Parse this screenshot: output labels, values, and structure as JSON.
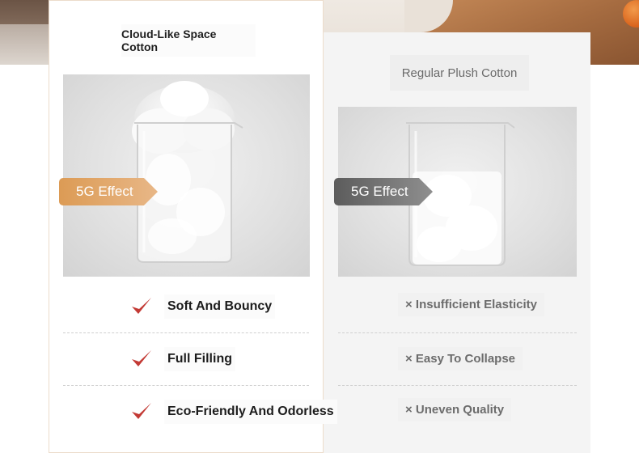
{
  "comparison": {
    "left": {
      "title": "Cloud-Like Space Cotton",
      "badge": "5G Effect",
      "features": [
        {
          "text": "Soft And Bouncy",
          "icon": "check-icon"
        },
        {
          "text": "Full Filling",
          "icon": "check-icon"
        },
        {
          "text": "Eco-Friendly And Odorless",
          "icon": "check-icon"
        }
      ]
    },
    "right": {
      "title": "Regular Plush Cotton",
      "badge": "5G Effect",
      "features": [
        {
          "text": "× Insufficient Elasticity"
        },
        {
          "text": "× Easy To Collapse"
        },
        {
          "text": "× Uneven Quality"
        }
      ]
    }
  },
  "colors": {
    "check_red": "#c33a35",
    "badge_left": "#dc9b55",
    "badge_right": "#6a6a6a",
    "panel_border": "#ecdccb"
  }
}
